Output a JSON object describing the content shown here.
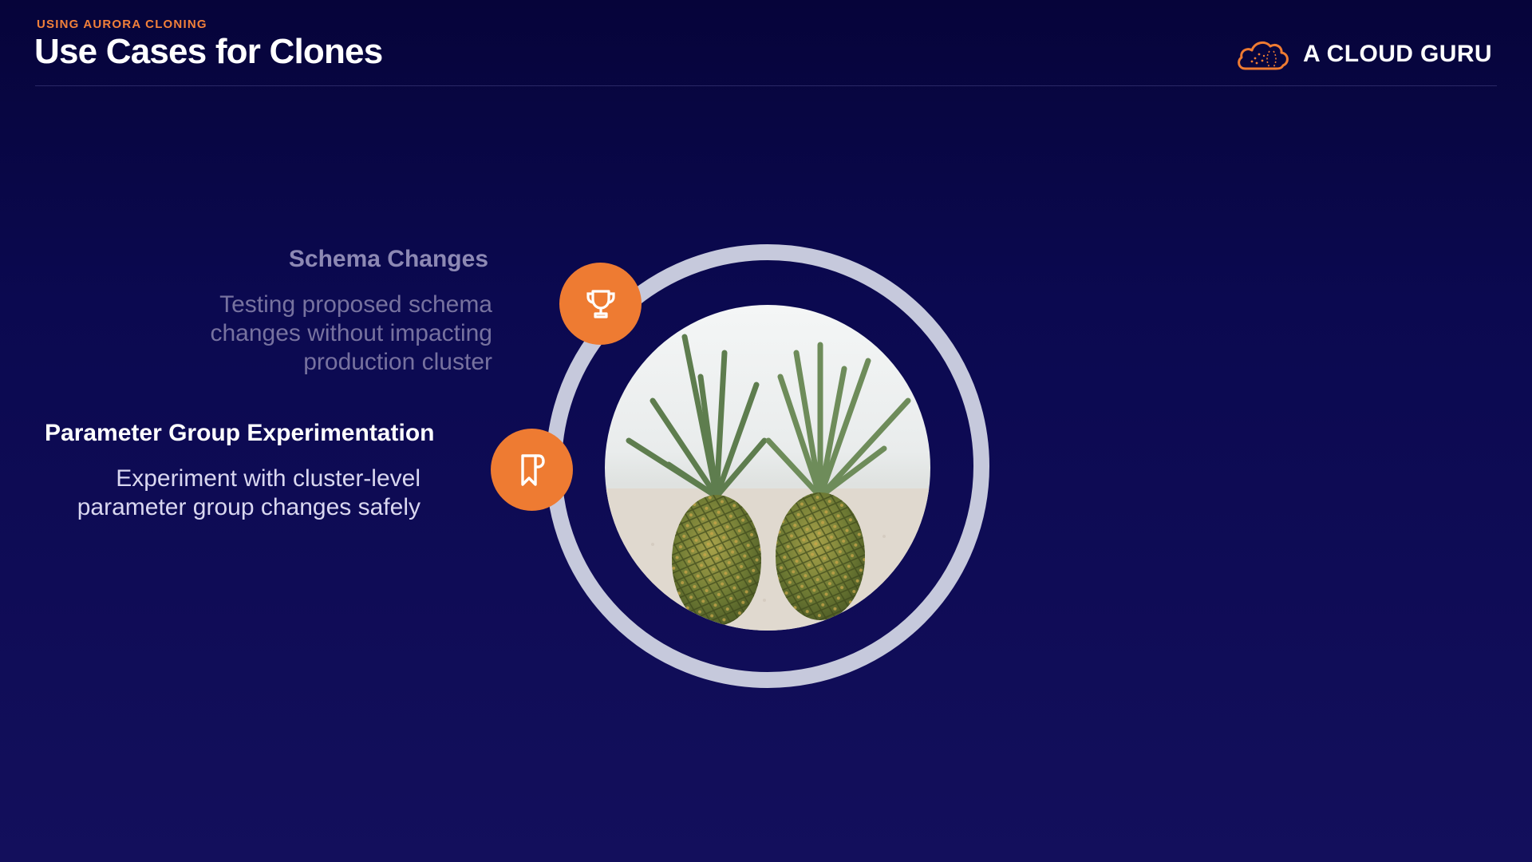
{
  "header": {
    "eyebrow": "USING AURORA CLONING",
    "title": "Use Cases for Clones",
    "brand": "A CLOUD GURU"
  },
  "use_cases": [
    {
      "title": "Schema Changes",
      "description": "Testing proposed schema changes without impacting production cluster",
      "icon": "trophy-icon",
      "state": "dimmed"
    },
    {
      "title": "Parameter Group Experimentation",
      "description": "Experiment with cluster-level parameter group changes safely",
      "icon": "bookmark-icon",
      "state": "active"
    }
  ],
  "colors": {
    "accent": "#ee7b32",
    "background": "#0b0950",
    "ring": "#c6c9dc"
  }
}
